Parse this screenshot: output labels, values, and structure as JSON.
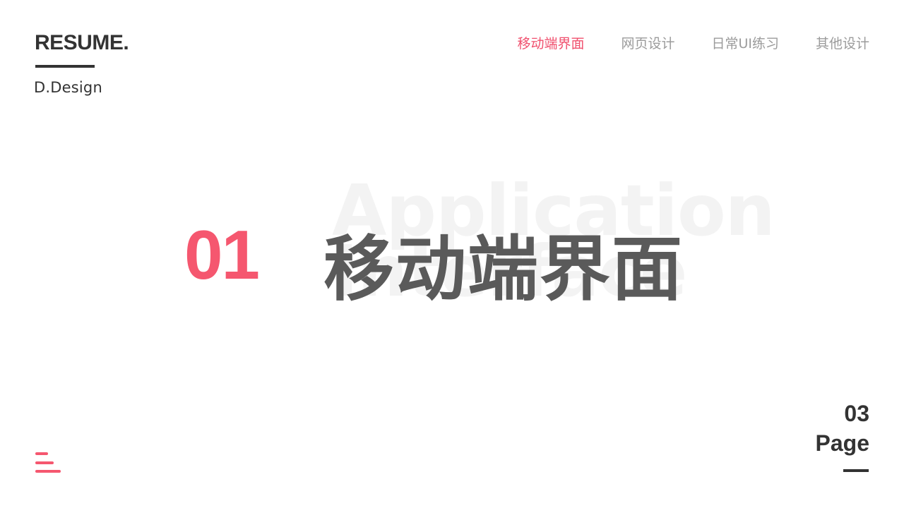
{
  "brand": {
    "title": "RESUME.",
    "subtitle": "D.Design"
  },
  "nav": {
    "items": [
      "移动端界面",
      "网页设计",
      "日常UI练习",
      "其他设计"
    ],
    "active_index": 0
  },
  "hero": {
    "number": "01",
    "title": "移动端界面",
    "background_lines": [
      "Application",
      "Interface"
    ]
  },
  "pager": {
    "number": "03",
    "label": "Page"
  },
  "colors": {
    "accent": "#f5576f",
    "text_dark": "#333333",
    "title_gray": "#5a5a5a",
    "nav_gray": "#9b9b9b"
  },
  "icons": {
    "menu": "menu-icon"
  }
}
